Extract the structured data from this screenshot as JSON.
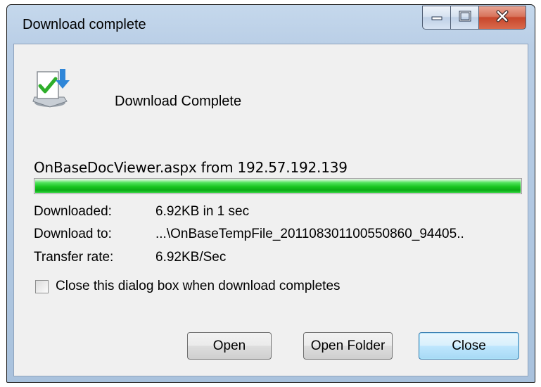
{
  "window": {
    "title": "Download complete",
    "controls": {
      "minimize": "minimize-icon",
      "maximize": "maximize-icon",
      "close": "close-icon"
    }
  },
  "header": {
    "icon": "download-complete-icon",
    "text": "Download Complete"
  },
  "file_line": "OnBaseDocViewer.aspx from 192.57.192.139",
  "progress": {
    "percent": 100,
    "color": "#19c521"
  },
  "details": [
    {
      "label": "Downloaded:",
      "value": "6.92KB in 1 sec"
    },
    {
      "label": "Download to:",
      "value": "...\\OnBaseTempFile_201108301100550860_94405.."
    },
    {
      "label": "Transfer rate:",
      "value": "6.92KB/Sec"
    }
  ],
  "close_when_done": {
    "label": "Close this dialog box when download completes",
    "checked": false
  },
  "buttons": {
    "open": "Open",
    "open_folder": "Open Folder",
    "close": "Close"
  }
}
